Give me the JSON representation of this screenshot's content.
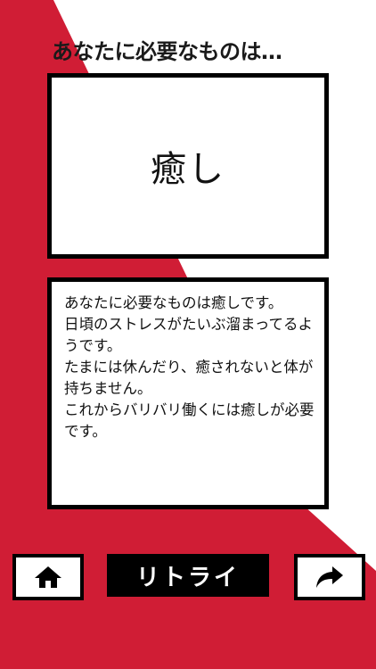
{
  "colors": {
    "accent_red": "#d01d35",
    "background": "#ffffff",
    "frame": "#000000"
  },
  "header": {
    "title": "あなたに必要なものは…"
  },
  "result": {
    "word": "癒し"
  },
  "description": {
    "text": "あなたに必要なものは癒しです。\n日頃のストレスがたいぶ溜まってるようです。\nたまには休んだり、癒されないと体が持ちません。\nこれからバリバリ働くには癒しが必要です。"
  },
  "buttons": {
    "home_icon": "home-icon",
    "retry_label": "リトライ",
    "share_icon": "share-arrow-icon"
  }
}
